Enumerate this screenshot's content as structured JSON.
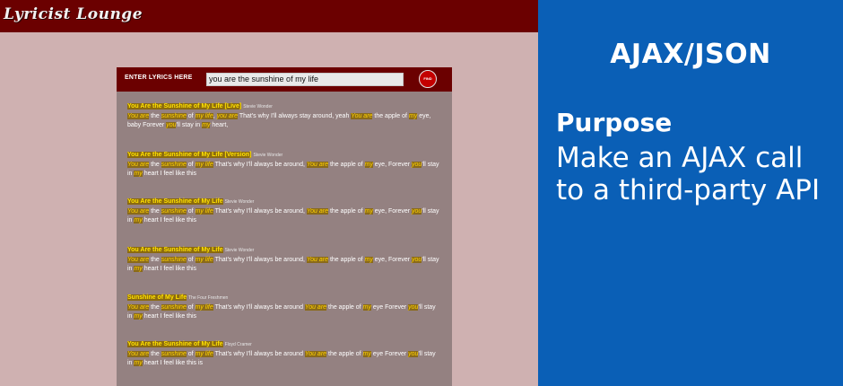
{
  "app": {
    "logo": "Lyricist Lounge",
    "search_label": "ENTER LYRICS HERE",
    "search_value": "you are the sunshine of my life",
    "find_label": "FIND"
  },
  "results": [
    {
      "title": "You Are the Sunshine of My Life [Live]",
      "artist": "Stevie Wonder",
      "snippet": [
        {
          "t": "You are",
          "h": true
        },
        {
          "t": " the ",
          "h": false
        },
        {
          "t": "sunshine",
          "h": true
        },
        {
          "t": " of ",
          "h": false
        },
        {
          "t": "my life",
          "h": true
        },
        {
          "t": ", ",
          "h": false
        },
        {
          "t": "you are",
          "h": true
        },
        {
          "t": " That's why I'll always stay around, yeah ",
          "h": false
        },
        {
          "t": "You are",
          "h": true
        },
        {
          "t": " the apple of ",
          "h": false
        },
        {
          "t": "my",
          "h": true
        },
        {
          "t": " eye, baby Forever ",
          "h": false
        },
        {
          "t": "you",
          "h": true
        },
        {
          "t": "'ll stay in ",
          "h": false
        },
        {
          "t": "my",
          "h": true
        },
        {
          "t": " heart,",
          "h": false
        }
      ]
    },
    {
      "title": "You Are the Sunshine of My Life [Version]",
      "artist": "Stevie Wonder",
      "snippet": [
        {
          "t": "You are",
          "h": true
        },
        {
          "t": " the ",
          "h": false
        },
        {
          "t": "sunshine",
          "h": true
        },
        {
          "t": " of ",
          "h": false
        },
        {
          "t": "my life",
          "h": true
        },
        {
          "t": " That's why I'll always be around, ",
          "h": false
        },
        {
          "t": "You are",
          "h": true
        },
        {
          "t": " the apple of ",
          "h": false
        },
        {
          "t": "my",
          "h": true
        },
        {
          "t": " eye, Forever ",
          "h": false
        },
        {
          "t": "you",
          "h": true
        },
        {
          "t": "'ll stay in ",
          "h": false
        },
        {
          "t": "my",
          "h": true
        },
        {
          "t": " heart I feel like this",
          "h": false
        }
      ]
    },
    {
      "title": "You Are the Sunshine of My Life",
      "artist": "Stevie Wonder",
      "snippet": [
        {
          "t": "You are",
          "h": true
        },
        {
          "t": " the ",
          "h": false
        },
        {
          "t": "sunshine",
          "h": true
        },
        {
          "t": " of ",
          "h": false
        },
        {
          "t": "my life",
          "h": true
        },
        {
          "t": " That's why I'll always be around, ",
          "h": false
        },
        {
          "t": "You are",
          "h": true
        },
        {
          "t": " the apple of ",
          "h": false
        },
        {
          "t": "my",
          "h": true
        },
        {
          "t": " eye, Forever ",
          "h": false
        },
        {
          "t": "you",
          "h": true
        },
        {
          "t": "'ll stay in ",
          "h": false
        },
        {
          "t": "my",
          "h": true
        },
        {
          "t": " heart I feel like this",
          "h": false
        }
      ]
    },
    {
      "title": "You Are the Sunshine of My Life",
      "artist": "Stevie Wonder",
      "snippet": [
        {
          "t": "You are",
          "h": true
        },
        {
          "t": " the ",
          "h": false
        },
        {
          "t": "sunshine",
          "h": true
        },
        {
          "t": " of ",
          "h": false
        },
        {
          "t": "my life",
          "h": true
        },
        {
          "t": " That's why I'll always be around, ",
          "h": false
        },
        {
          "t": "You are",
          "h": true
        },
        {
          "t": " the apple of ",
          "h": false
        },
        {
          "t": "my",
          "h": true
        },
        {
          "t": " eye, Forever ",
          "h": false
        },
        {
          "t": "you",
          "h": true
        },
        {
          "t": "'ll stay in ",
          "h": false
        },
        {
          "t": "my",
          "h": true
        },
        {
          "t": " heart I feel like this",
          "h": false
        }
      ]
    },
    {
      "title": "Sunshine of My Life",
      "artist": "The Four Freshmen",
      "snippet": [
        {
          "t": "You are",
          "h": true
        },
        {
          "t": " the ",
          "h": false
        },
        {
          "t": "sunshine",
          "h": true
        },
        {
          "t": " of ",
          "h": false
        },
        {
          "t": "my life",
          "h": true
        },
        {
          "t": " That's why I'll always be around ",
          "h": false
        },
        {
          "t": "You are",
          "h": true
        },
        {
          "t": " the apple of ",
          "h": false
        },
        {
          "t": "my",
          "h": true
        },
        {
          "t": " eye Forever ",
          "h": false
        },
        {
          "t": "you",
          "h": true
        },
        {
          "t": "'ll stay in ",
          "h": false
        },
        {
          "t": "my",
          "h": true
        },
        {
          "t": " heart I feel like this",
          "h": false
        }
      ]
    },
    {
      "title": "You Are the Sunshine of My Life",
      "artist": "Floyd Cramer",
      "snippet": [
        {
          "t": "You are",
          "h": true
        },
        {
          "t": " the ",
          "h": false
        },
        {
          "t": "sunshine",
          "h": true
        },
        {
          "t": " of ",
          "h": false
        },
        {
          "t": "my life",
          "h": true
        },
        {
          "t": " That's why I'll always be around ",
          "h": false
        },
        {
          "t": "You are",
          "h": true
        },
        {
          "t": " the apple of ",
          "h": false
        },
        {
          "t": "my",
          "h": true
        },
        {
          "t": " eye Forever ",
          "h": false
        },
        {
          "t": "you",
          "h": true
        },
        {
          "t": "'ll stay in ",
          "h": false
        },
        {
          "t": "my",
          "h": true
        },
        {
          "t": " heart I feel like this is",
          "h": false
        }
      ]
    }
  ],
  "info": {
    "title": "AJAX/JSON",
    "purpose_heading": "Purpose",
    "purpose_text": "Make an AJAX call to a third-party API"
  },
  "colors": {
    "topbar": "#6b0000",
    "panel": "#948181",
    "highlight": "#ffd200",
    "info_bg": "#0a5fb6"
  }
}
